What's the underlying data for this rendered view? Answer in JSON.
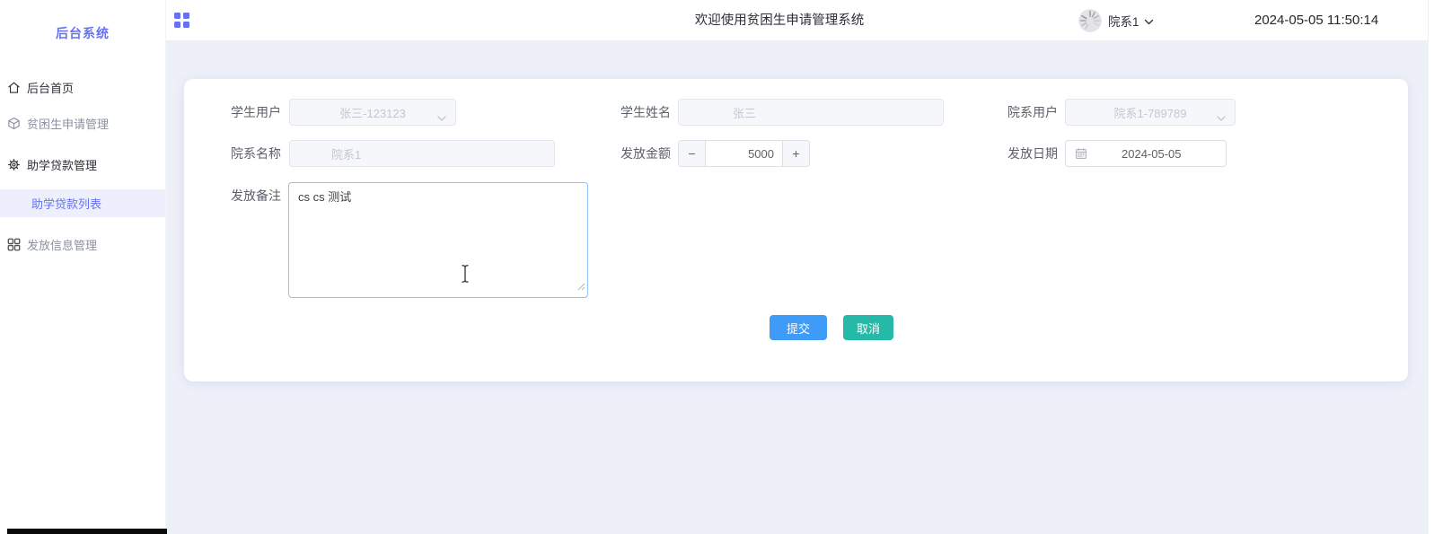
{
  "sidebar": {
    "logo": "后台系统",
    "items": [
      {
        "label": "后台首页"
      },
      {
        "label": "贫困生申请管理"
      },
      {
        "label": "助学贷款管理"
      },
      {
        "label": "助学贷款列表"
      },
      {
        "label": "发放信息管理"
      }
    ]
  },
  "header": {
    "title": "欢迎使用贫困生申请管理系统",
    "username": "院系1",
    "datetime": "2024-05-05 11:50:14"
  },
  "form": {
    "student_user": {
      "label": "学生用户",
      "value": "张三-123123"
    },
    "student_name": {
      "label": "学生姓名",
      "value": "张三"
    },
    "dept_user": {
      "label": "院系用户",
      "value": "院系1-789789"
    },
    "dept_name": {
      "label": "院系名称",
      "value": "院系1"
    },
    "amount": {
      "label": "发放金额",
      "value": "5000",
      "decrease": "−",
      "increase": "+"
    },
    "issue_date": {
      "label": "发放日期",
      "value": "2024-05-05"
    },
    "remark": {
      "label": "发放备注",
      "value": "cs cs 测试"
    },
    "submit_label": "提交",
    "cancel_label": "取消"
  },
  "colors": {
    "brand_purple": "#6672f2",
    "submit_blue": "#3f9bf8",
    "cancel_teal": "#26b9a8",
    "active_item_bg": "#edeffc"
  }
}
